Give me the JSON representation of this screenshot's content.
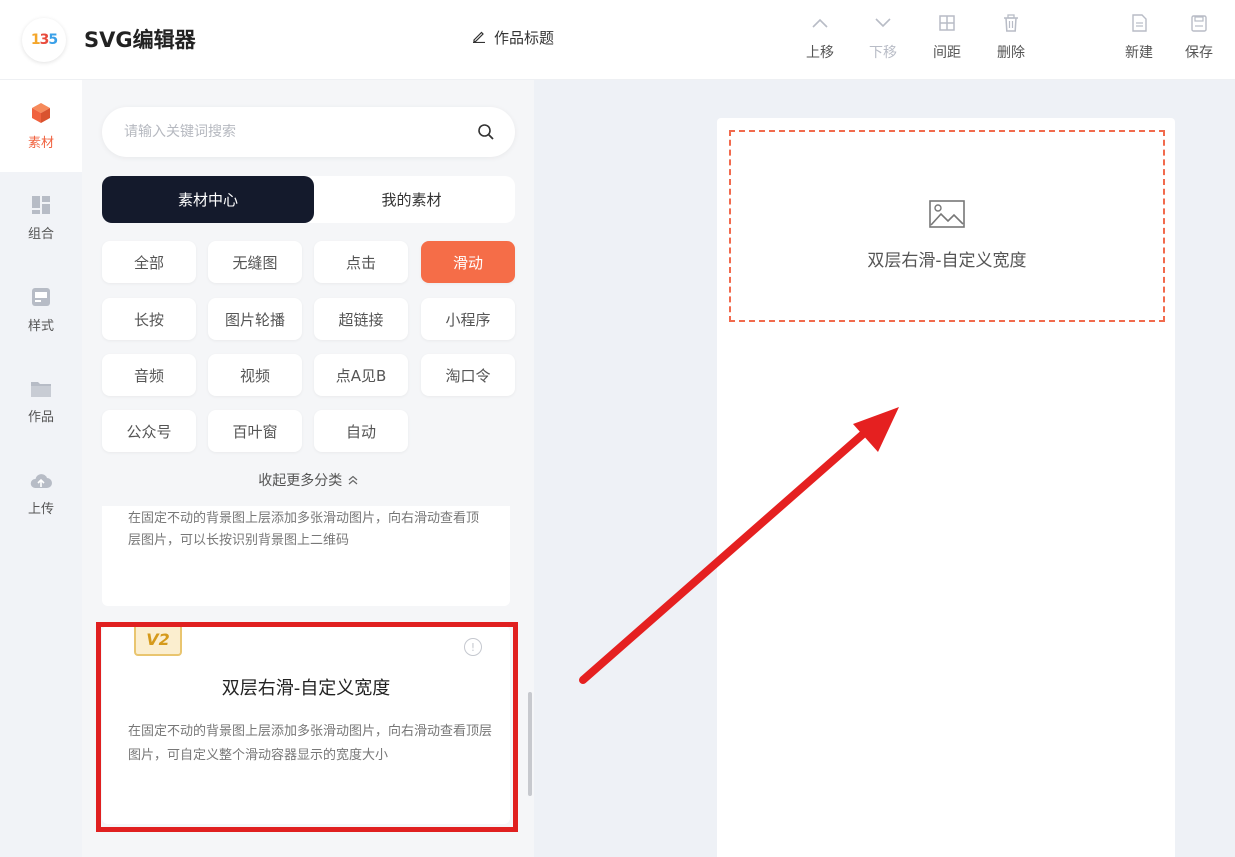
{
  "header": {
    "app_title": "SVG编辑器",
    "work_title": "作品标题",
    "tools": [
      {
        "icon": "chevron-up-icon",
        "label": "上移"
      },
      {
        "icon": "chevron-down-icon",
        "label": "下移"
      },
      {
        "icon": "spacing-icon",
        "label": "间距"
      },
      {
        "icon": "trash-icon",
        "label": "删除"
      },
      {
        "icon": "new-file-icon",
        "label": "新建"
      },
      {
        "icon": "save-icon",
        "label": "保存"
      }
    ]
  },
  "left_nav": [
    {
      "icon": "cube-icon",
      "label": "素材",
      "active": true
    },
    {
      "icon": "grid-icon",
      "label": "组合"
    },
    {
      "icon": "style-icon",
      "label": "样式"
    },
    {
      "icon": "folder-icon",
      "label": "作品"
    },
    {
      "icon": "cloud-upload-icon",
      "label": "上传"
    }
  ],
  "panel": {
    "search_placeholder": "请输入关键词搜索",
    "segments": [
      "素材中心",
      "我的素材"
    ],
    "categories": [
      "全部",
      "无缝图",
      "点击",
      "滑动",
      "长按",
      "图片轮播",
      "超链接",
      "小程序",
      "音频",
      "视频",
      "点A见B",
      "淘口令",
      "公众号",
      "百叶窗",
      "自动"
    ],
    "active_category": "滑动",
    "collapse_label": "收起更多分类",
    "card1_desc": "在固定不动的背景图上层添加多张滑动图片，向右滑动查看顶层图片，可以长按识别背景图上二维码",
    "card2": {
      "badge": "V2",
      "title": "双层右滑-自定义宽度",
      "desc": "在固定不动的背景图上层添加多张滑动图片，向右滑动查看顶层图片，可自定义整个滑动容器显示的宽度大小"
    }
  },
  "canvas": {
    "placeholder_label": "双层右滑-自定义宽度"
  },
  "colors": {
    "accent": "#f56d48",
    "dark": "#141a2c",
    "annotation": "#e02020"
  }
}
